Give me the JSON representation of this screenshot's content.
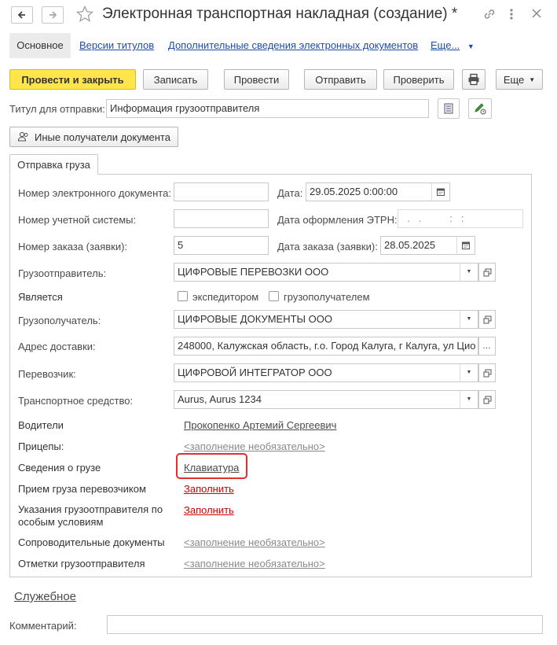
{
  "window": {
    "title": "Электронная транспортная накладная (создание) *",
    "back_icon": "arrow-left-icon",
    "forward_icon": "arrow-right-icon",
    "star_icon": "star-icon",
    "link_icon": "link-icon",
    "more_icon": "more-vertical-icon",
    "close_icon": "close-icon"
  },
  "tabs": {
    "main": "Основное",
    "versions": "Версии титулов",
    "extra": "Дополнительные сведения электронных документов",
    "more": "Еще..."
  },
  "toolbar": {
    "post_close": "Провести и закрыть",
    "save": "Записать",
    "post": "Провести",
    "send": "Отправить",
    "check": "Проверить",
    "more": "Еще"
  },
  "title_send": {
    "label": "Титул для отправки:",
    "value": "Информация грузоотправителя"
  },
  "other_recipients": "Иные получатели документа",
  "section_tab": "Отправка груза",
  "form": {
    "doc_number_label": "Номер электронного документа:",
    "doc_number_value": "",
    "date_label": "Дата:",
    "date_value": "29.05.2025  0:00:00",
    "account_number_label": "Номер учетной системы:",
    "account_number_value": "",
    "etrn_date_label": "Дата оформления ЭТРН:",
    "etrn_date_value": "  .   .          :   :",
    "order_number_label": "Номер заказа (заявки):",
    "order_number_value": "5",
    "order_date_label": "Дата заказа (заявки):",
    "order_date_value": "28.05.2025",
    "shipper_label": "Грузоотправитель:",
    "shipper_value": "ЦИФРОВЫЕ ПЕРЕВОЗКИ ООО",
    "is_label": "Является",
    "forwarder_label": "экспедитором",
    "consignee_check_label": "грузополучателем",
    "consignee_label": "Грузополучатель:",
    "consignee_value": "ЦИФРОВЫЕ ДОКУМЕНТЫ ООО",
    "address_label": "Адрес доставки:",
    "address_value": "248000, Калужская область, г.о. Город Калуга, г Калуга, ул Цио",
    "carrier_label": "Перевозчик:",
    "carrier_value": "ЦИФРОВОЙ ИНТЕГРАТОР ООО",
    "vehicle_label": "Транспортное средство:",
    "vehicle_value": "Aurus, Aurus 1234",
    "drivers_label": "Водители",
    "drivers_value": "Прокопенко Артемий Сергеевич",
    "trailers_label": "Прицепы:",
    "trailers_value": "<заполнение необязательно>",
    "cargo_label": "Сведения о грузе",
    "cargo_value": "Клавиатура",
    "acceptance_label": "Прием груза перевозчиком",
    "acceptance_value": "Заполнить",
    "instructions_label_1": "Указания грузоотправителя по",
    "instructions_label_2": "особым условиям",
    "instructions_value": "Заполнить",
    "accompanying_label": "Сопроводительные документы",
    "accompanying_value": "<заполнение необязательно>",
    "shipper_marks_label": "Отметки грузоотправителя",
    "shipper_marks_value": "<заполнение необязательно>"
  },
  "service_link": "Служебное",
  "comment": {
    "label": "Комментарий:",
    "value": ""
  },
  "colors": {
    "primary_button": "#ffe54c",
    "link": "#1c4ea8",
    "required_link": "#d40000",
    "highlight": "#e0302a"
  }
}
